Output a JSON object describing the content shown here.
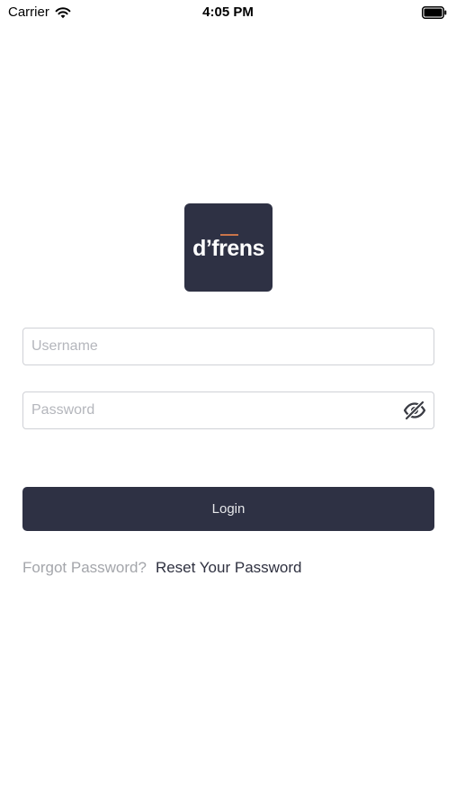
{
  "status_bar": {
    "carrier": "Carrier",
    "time": "4:05 PM",
    "wifi_icon": "wifi-icon",
    "battery_icon": "battery-icon"
  },
  "logo": {
    "text": "d’frens",
    "background": "#2e3144",
    "accent": "#c9744a"
  },
  "form": {
    "username_placeholder": "Username",
    "username_value": "",
    "password_placeholder": "Password",
    "password_value": "",
    "password_toggle_icon": "eye-slash-icon"
  },
  "login_button": {
    "label": "Login",
    "background": "#2e3144"
  },
  "forgot": {
    "prompt": "Forgot Password?",
    "link": "Reset Your Password"
  }
}
